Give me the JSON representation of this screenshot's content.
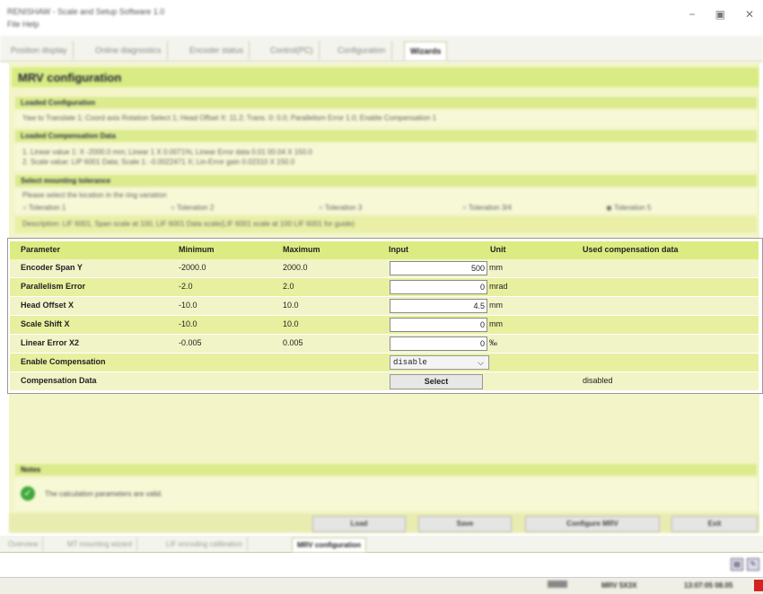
{
  "window": {
    "title": "RENISHAW - Scale and Setup Software 1.0",
    "menu": "File Help",
    "controls": [
      "−",
      "▣",
      "✕"
    ]
  },
  "top_tabs": [
    "Position display",
    "Online diagnostics",
    "Encoder status",
    "Control(PC)",
    "Configuration",
    "Wizards"
  ],
  "panel_title": "MRV configuration",
  "loaded_config": {
    "title": "Loaded Configuration",
    "text": "Yaw to Translate 1; Coord axis Rotation Select 1; Head Offset X: 11.2; Trans. 0: 0.0; Parallelism Error 1.0; Enable Compensation 1"
  },
  "loaded_comp": {
    "title": "Loaded Compensation Data",
    "lines": [
      "1. Linear value 1: X -2000.0 mm; Linear 1 X 0.0071%; Linear Error data 0.01 00.04 X 150.0",
      "2. Scale value: LIP 6001 Data; Scale 1: -0.0022471 X; Lin-Error gain 0.02310 X 150.0"
    ]
  },
  "mounting": {
    "title": "Select mounting tolerance",
    "hint": "Please select the location in the ring variation",
    "options": [
      "Toleration 1",
      "Toleration 2",
      "Toleration 3",
      "Toleration 3/4",
      "Toleration 5"
    ],
    "selected_index": 4,
    "desc": "Description: LIF 6001, Span scale at 100, LIF 6001 Data scale(LIF 6001 scale at 100 LIF 6001 for guide)"
  },
  "table": {
    "headers": {
      "parameter": "Parameter",
      "minimum": "Minimum",
      "maximum": "Maximum",
      "input": "Input",
      "unit": "Unit",
      "used": "Used compensation data"
    },
    "rows": [
      {
        "name": "Encoder Span Y",
        "min": "-2000.0",
        "max": "2000.0",
        "input": "500",
        "unit": "mm"
      },
      {
        "name": "Parallelism Error",
        "min": "-2.0",
        "max": "2.0",
        "input": "0",
        "unit": "mrad"
      },
      {
        "name": "Head Offset X",
        "min": "-10.0",
        "max": "10.0",
        "input": "4.5",
        "unit": "mm"
      },
      {
        "name": "Scale Shift X",
        "min": "-10.0",
        "max": "10.0",
        "input": "0",
        "unit": "mm"
      },
      {
        "name": "Linear Error X2",
        "min": "-0.005",
        "max": "0.005",
        "input": "0",
        "unit": "‰"
      }
    ],
    "enable": {
      "name": "Enable Compensation",
      "value": "disable"
    },
    "compdata": {
      "name": "Compensation Data",
      "button": "Select",
      "status": "disabled"
    }
  },
  "notes": {
    "title": "Notes",
    "message": "The calculation parameters are valid."
  },
  "action_buttons": [
    "Load",
    "Save",
    "Configure MRV",
    "Exit"
  ],
  "bottom_tabs": [
    "Overview",
    "MT mounting wizard",
    "LIF encoding calibration",
    "MRV configuration"
  ],
  "status_bar": [
    "MRV 5X3X",
    "13:07:05 08.05"
  ],
  "colors": {
    "panel": "#f3f5c9",
    "header": "#d8ec83",
    "row_light": "#f1f4c6",
    "row_dark": "#e8ef9e",
    "ok_green": "#3fa83a",
    "status_red": "#d42222"
  }
}
